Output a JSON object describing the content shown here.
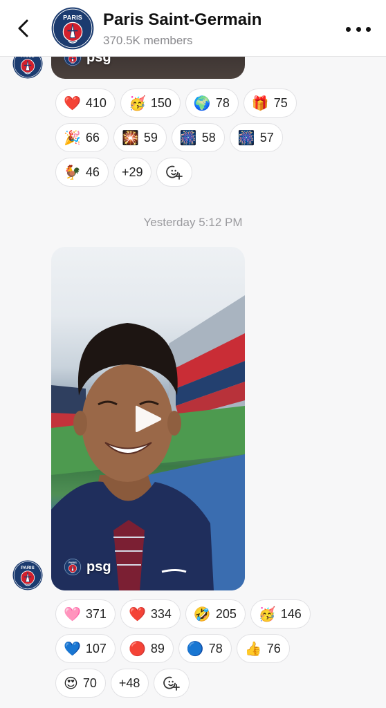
{
  "header": {
    "title": "Paris Saint-Germain",
    "members": "370.5K members",
    "back_icon": "chevron-left-icon",
    "more_icon": "more-horizontal-icon"
  },
  "colors": {
    "psg_navy": "#1b3b6f",
    "psg_red": "#d3202d",
    "chip_border": "#e1e1e4",
    "muted": "#8a8a8e"
  },
  "previous_post": {
    "handle": "psg",
    "reactions": [
      {
        "emoji": "❤️",
        "icon": "red-heart-icon",
        "count": "410"
      },
      {
        "emoji": "🥳",
        "icon": "partying-face-icon",
        "count": "150"
      },
      {
        "emoji": "🌍",
        "icon": "globe-icon",
        "count": "78"
      },
      {
        "emoji": "🎁",
        "icon": "gift-icon",
        "count": "75"
      },
      {
        "emoji": "🎉",
        "icon": "party-popper-icon",
        "count": "66"
      },
      {
        "emoji": "🎇",
        "icon": "fireworks-icon",
        "count": "59"
      },
      {
        "emoji": "🎆",
        "icon": "sparkler-icon",
        "count": "58"
      },
      {
        "emoji": "🎆",
        "icon": "fireworks-night-icon",
        "count": "57"
      },
      {
        "emoji": "🐓",
        "icon": "rooster-icon",
        "count": "46"
      }
    ],
    "more_count": "+29"
  },
  "timestamp": "Yesterday 5:12 PM",
  "video_post": {
    "handle": "psg",
    "reactions": [
      {
        "emoji": "🩷",
        "icon": "pink-heart-icon",
        "count": "371"
      },
      {
        "emoji": "❤️",
        "icon": "red-heart-icon",
        "count": "334"
      },
      {
        "emoji": "🤣",
        "icon": "rolling-laughing-icon",
        "count": "205"
      },
      {
        "emoji": "🥳",
        "icon": "partying-face-icon",
        "count": "146"
      },
      {
        "emoji": "💙",
        "icon": "blue-heart-icon",
        "count": "107"
      },
      {
        "emoji": "🔴",
        "icon": "red-circle-icon",
        "count": "89"
      },
      {
        "emoji": "🔵",
        "icon": "blue-circle-icon",
        "count": "78"
      },
      {
        "emoji": "👍",
        "icon": "thumbs-up-icon",
        "count": "76"
      },
      {
        "emoji": "😍",
        "icon": "heart-eyes-icon",
        "count": "70"
      }
    ],
    "more_count": "+48"
  }
}
